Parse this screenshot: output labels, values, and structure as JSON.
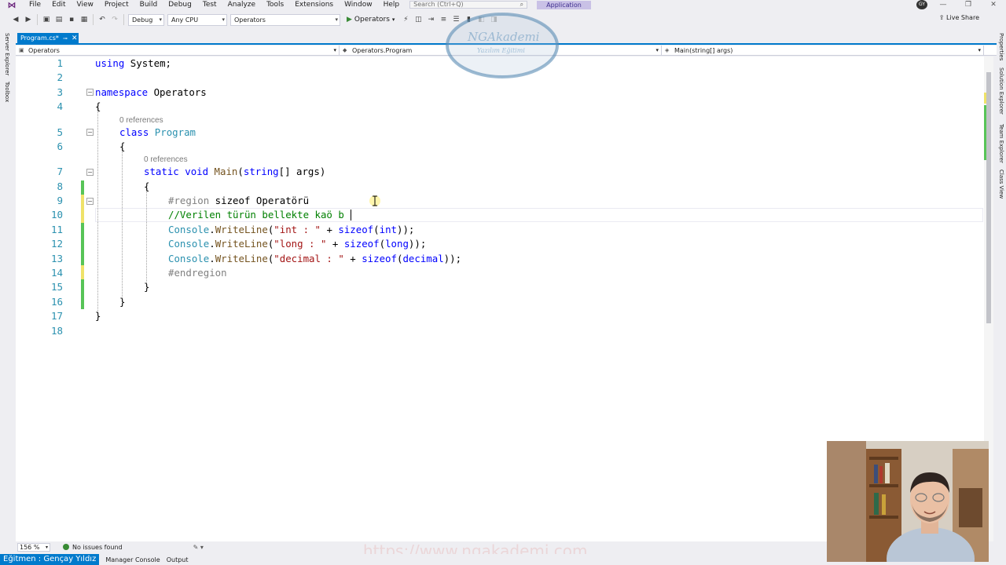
{
  "menu": {
    "items": [
      "File",
      "Edit",
      "View",
      "Project",
      "Build",
      "Debug",
      "Test",
      "Analyze",
      "Tools",
      "Extensions",
      "Window",
      "Help"
    ],
    "search_placeholder": "Search (Ctrl+Q)",
    "app_badge": "Application",
    "user_initials": "GY"
  },
  "toolbar": {
    "config": "Debug",
    "platform": "Any CPU",
    "startup_project": "Operators",
    "run_label": "Operators",
    "live_share": "Live Share"
  },
  "side_panels": {
    "left": [
      "Server Explorer",
      "Toolbox"
    ],
    "right": [
      "Properties",
      "Solution Explorer",
      "Team Explorer",
      "Class View"
    ]
  },
  "document_tab": {
    "label": "Program.cs*"
  },
  "navigation": {
    "project": "Operators",
    "type": "Operators.Program",
    "member": "Main(string[] args)"
  },
  "code": {
    "line_numbers": [
      "1",
      "2",
      "3",
      "4",
      "5",
      "6",
      "7",
      "8",
      "9",
      "10",
      "11",
      "12",
      "13",
      "14",
      "15",
      "16",
      "17",
      "18"
    ],
    "codelens": [
      "0 references",
      "0 references"
    ],
    "tokens": {
      "l1": [
        "using",
        " System;"
      ],
      "l3": [
        "namespace",
        " Operators"
      ],
      "l4": "{",
      "l5": [
        "class",
        " ",
        "Program"
      ],
      "l6": "{",
      "l7": [
        "static",
        " ",
        "void",
        " ",
        "Main",
        "(",
        "string",
        "[] args)"
      ],
      "l8": "{",
      "l9": [
        "#region",
        " sizeof Operatörü"
      ],
      "l10": "//Verilen türün bellekte kaö b",
      "l11": [
        "Console",
        ".",
        "WriteLine",
        "(",
        "\"int : \"",
        " + ",
        "sizeof",
        "(",
        "int",
        "));"
      ],
      "l12": [
        "Console",
        ".",
        "WriteLine",
        "(",
        "\"long : \"",
        " + ",
        "sizeof",
        "(",
        "long",
        "));"
      ],
      "l13": [
        "Console",
        ".",
        "WriteLine",
        "(",
        "\"decimal : \"",
        " + ",
        "sizeof",
        "(",
        "decimal",
        "));"
      ],
      "l14": "#endregion",
      "l15": "}",
      "l16": "}",
      "l17": "}"
    }
  },
  "editor_status": {
    "zoom": "156 %",
    "issues": "No issues found"
  },
  "statusbar": {
    "instructor": "Eğitmen : Gençay Yıldız",
    "tabs": [
      "Manager Console",
      "Output"
    ]
  },
  "branding": {
    "logo_name": "NGAkademi",
    "logo_tagline": "Yazılım Eğitimi",
    "url": "https://www.ngakademi.com"
  },
  "colors": {
    "accent": "#007acc",
    "keyword": "#0000ff",
    "type": "#2b91af",
    "string": "#a31515",
    "comment": "#008000",
    "change_saved": "#57c457",
    "change_unsaved": "#efe269"
  }
}
